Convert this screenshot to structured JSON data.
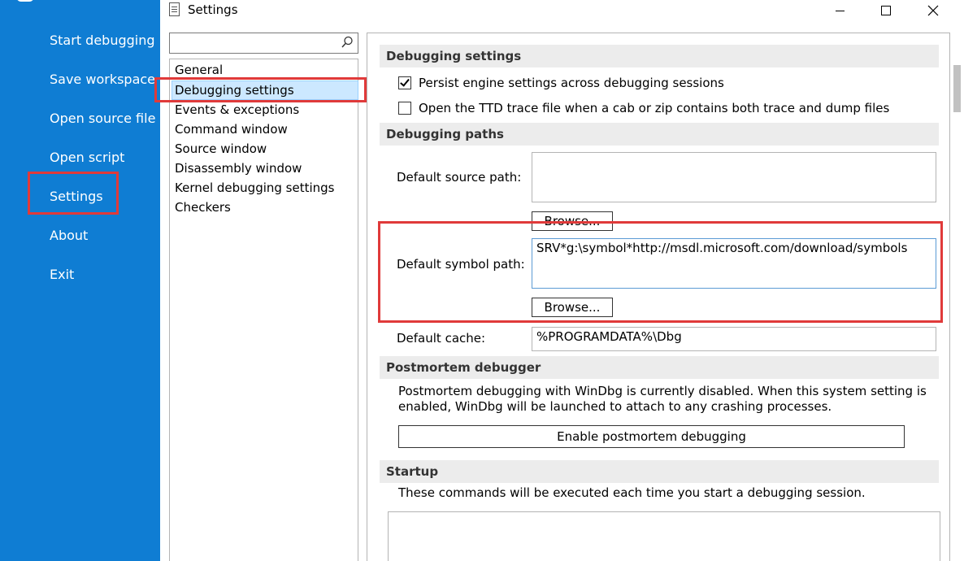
{
  "backstage": {
    "items": [
      "Start debugging",
      "Save workspace",
      "Open source file",
      "Open script",
      "Settings",
      "About",
      "Exit"
    ]
  },
  "window": {
    "title": "Settings",
    "minimize": "minimize",
    "maximize": "maximize",
    "close": "close"
  },
  "nav": {
    "search_value": "",
    "items": [
      "General",
      "Debugging settings",
      "Events & exceptions",
      "Command window",
      "Source window",
      "Disassembly window",
      "Kernel debugging settings",
      "Checkers"
    ],
    "selected": "Debugging settings"
  },
  "debugging_settings": {
    "heading": "Debugging settings",
    "persist_label": "Persist engine settings across debugging sessions",
    "persist_checked": true,
    "ttd_label": "Open the TTD trace file when a cab or zip contains both trace and dump files",
    "ttd_checked": false
  },
  "debugging_paths": {
    "heading": "Debugging paths",
    "source_label": "Default source path:",
    "source_value": "",
    "source_browse": "Browse...",
    "symbol_label": "Default symbol path:",
    "symbol_value": "SRV*g:\\symbol*http://msdl.microsoft.com/download/symbols",
    "symbol_browse": "Browse...",
    "cache_label": "Default cache:",
    "cache_value": "%PROGRAMDATA%\\Dbg"
  },
  "postmortem": {
    "heading": "Postmortem debugger",
    "description": "Postmortem debugging with WinDbg is currently disabled. When this system setting is enabled, WinDbg will be launched to attach to any crashing processes.",
    "button": "Enable postmortem debugging"
  },
  "startup": {
    "heading": "Startup",
    "description": "These commands will be executed each time you start a debugging session.",
    "commands_value": ""
  },
  "colors": {
    "backstage": "#0f7dd3",
    "selection": "#cce8ff",
    "highlight": "#e03a3a"
  }
}
